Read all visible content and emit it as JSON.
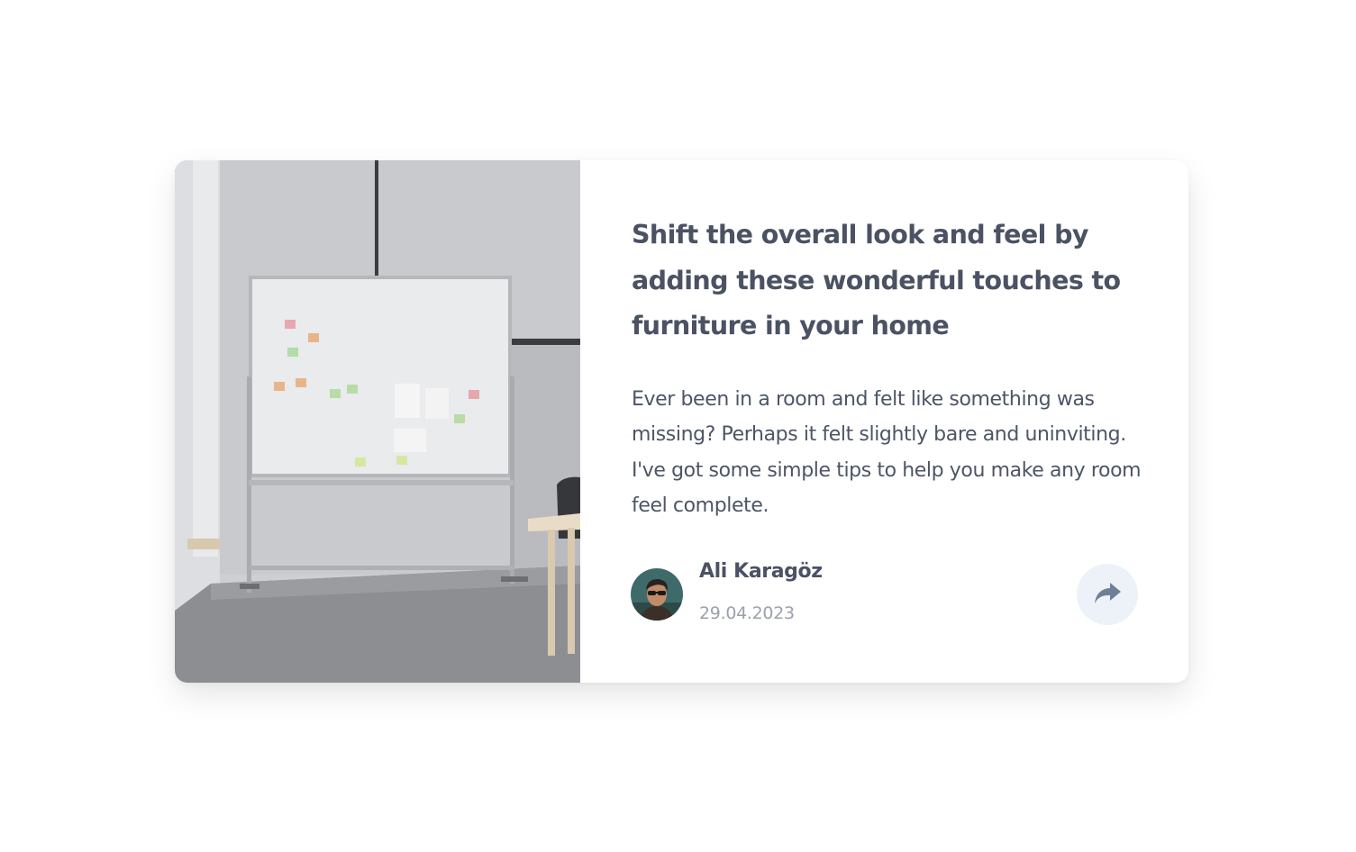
{
  "article": {
    "title": "Shift the overall look and feel by adding these wonderful touches to furniture in your home",
    "description": "Ever been in a room and felt like something was missing? Perhaps it felt slightly bare and uninviting. I've got some simple tips to help you make any room feel complete."
  },
  "author": {
    "name": "Ali Karagöz",
    "date": "29.04.2023"
  },
  "share": {
    "icon": "share-arrow-icon"
  },
  "colors": {
    "title": "#4a5263",
    "text": "#4d5566",
    "muted": "#9ba1ad",
    "share_bg": "#edf2f8",
    "share_icon": "#6e8098"
  }
}
